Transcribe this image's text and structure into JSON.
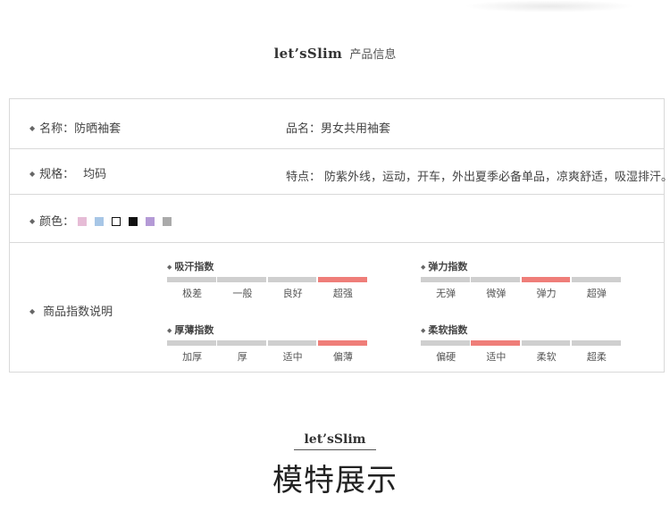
{
  "header": {
    "brand": "let’sSlim",
    "subtitle": "产品信息"
  },
  "rows": {
    "name_label": "名称：防晒袖套",
    "product_label": "品名：男女共用袖套",
    "spec_label": "规格：",
    "spec_value": "均码",
    "features_label": "特点：",
    "features_value": "防紫外线，运动，开车，外出夏季必备单品，凉爽舒适，吸湿排汗。",
    "color_label": "颜色：",
    "colors": [
      "#e6bcd6",
      "#a7c6e6",
      "#ffffff",
      "#111111",
      "#b49ad6",
      "#aaaaaa"
    ],
    "index_label": "商品指数说明"
  },
  "indexes": [
    {
      "title": "吸汗指数",
      "labels": [
        "极差",
        "一般",
        "良好",
        "超强"
      ],
      "active": 3
    },
    {
      "title": "弹力指数",
      "labels": [
        "无弹",
        "微弹",
        "弹力",
        "超弹"
      ],
      "active": 2
    },
    {
      "title": "厚薄指数",
      "labels": [
        "加厚",
        "厚",
        "适中",
        "偏薄"
      ],
      "active": 3
    },
    {
      "title": "柔软指数",
      "labels": [
        "偏硬",
        "适中",
        "柔软",
        "超柔"
      ],
      "active": 1
    }
  ],
  "footer": {
    "brand": "let’sSlim",
    "title": "模特展示"
  }
}
